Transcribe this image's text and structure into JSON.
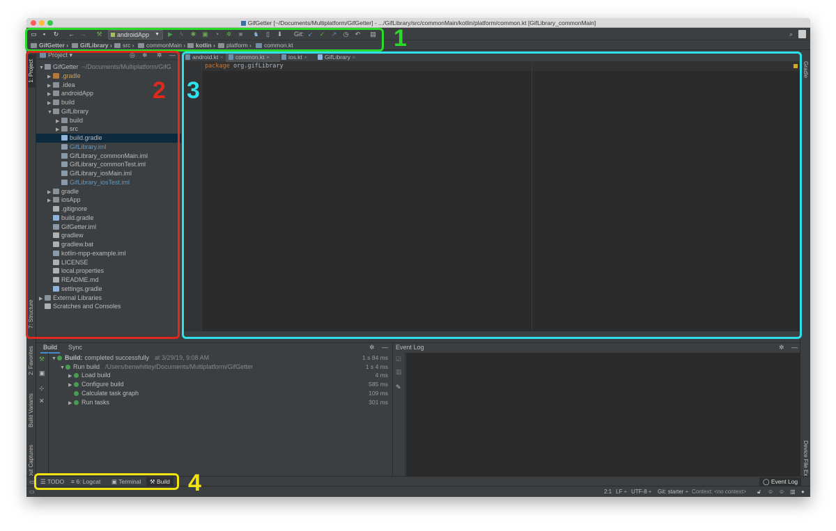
{
  "window": {
    "title": "GifGetter [~/Documents/Multiplatform/GifGetter] - .../GifLibrary/src/commonMain/kotlin/platform/common.kt [GifLibrary_commonMain]"
  },
  "toolbar": {
    "run_config": "androidApp",
    "git_label": "Git:"
  },
  "navbar": {
    "crumbs": [
      "GifGetter",
      "GifLibrary",
      "src",
      "commonMain",
      "kotlin",
      "platform",
      "common.kt"
    ]
  },
  "left_stripe": {
    "project_tab": "1: Project",
    "structure_tab": "7: Structure",
    "favorites_tab": "2: Favorites",
    "build_variants_tab": "Build Variants",
    "layout_captures_tab": "Layout Captures"
  },
  "project_panel": {
    "view_selector": "Project",
    "tree": [
      {
        "label": "GifGetter",
        "path": "~/Documents/Multiplatform/GifG",
        "depth": 0,
        "arrow": "▼"
      },
      {
        "label": ".gradle",
        "depth": 1,
        "arrow": "▶"
      },
      {
        "label": ".idea",
        "depth": 1,
        "arrow": "▶"
      },
      {
        "label": "androidApp",
        "depth": 1,
        "arrow": "▶"
      },
      {
        "label": "build",
        "depth": 1,
        "arrow": "▶"
      },
      {
        "label": "GifLibrary",
        "depth": 1,
        "arrow": "▼"
      },
      {
        "label": "build",
        "depth": 2,
        "arrow": "▶"
      },
      {
        "label": "src",
        "depth": 2,
        "arrow": "▶"
      },
      {
        "label": "build.gradle",
        "depth": 2,
        "arrow": ""
      },
      {
        "label": "GifLibrary.iml",
        "depth": 2,
        "arrow": ""
      },
      {
        "label": "GifLibrary_commonMain.iml",
        "depth": 2,
        "arrow": ""
      },
      {
        "label": "GifLibrary_commonTest.iml",
        "depth": 2,
        "arrow": ""
      },
      {
        "label": "GifLibrary_iosMain.iml",
        "depth": 2,
        "arrow": ""
      },
      {
        "label": "GifLibrary_iosTest.iml",
        "depth": 2,
        "arrow": ""
      },
      {
        "label": "gradle",
        "depth": 1,
        "arrow": "▶"
      },
      {
        "label": "iosApp",
        "depth": 1,
        "arrow": "▶"
      },
      {
        "label": ".gitignore",
        "depth": 1,
        "arrow": ""
      },
      {
        "label": "build.gradle",
        "depth": 1,
        "arrow": ""
      },
      {
        "label": "GifGetter.iml",
        "depth": 1,
        "arrow": ""
      },
      {
        "label": "gradlew",
        "depth": 1,
        "arrow": ""
      },
      {
        "label": "gradlew.bat",
        "depth": 1,
        "arrow": ""
      },
      {
        "label": "kotlin-mpp-example.iml",
        "depth": 1,
        "arrow": ""
      },
      {
        "label": "LICENSE",
        "depth": 1,
        "arrow": ""
      },
      {
        "label": "local.properties",
        "depth": 1,
        "arrow": ""
      },
      {
        "label": "README.md",
        "depth": 1,
        "arrow": ""
      },
      {
        "label": "settings.gradle",
        "depth": 1,
        "arrow": ""
      },
      {
        "label": "External Libraries",
        "depth": 0,
        "arrow": "▶"
      },
      {
        "label": "Scratches and Consoles",
        "depth": 0,
        "arrow": ""
      }
    ]
  },
  "editor": {
    "tabs": [
      {
        "label": "android.kt"
      },
      {
        "label": "common.kt"
      },
      {
        "label": "ios.kt"
      },
      {
        "label": "GifLibrary"
      }
    ],
    "code_keyword": "package",
    "code_package": "org.gifLibrary"
  },
  "right_stripe": {
    "gradle_tab": "Gradle",
    "device_explorer_tab": "Device File Explorer"
  },
  "build_panel": {
    "tabs": [
      "Build",
      "Sync"
    ],
    "rows": [
      {
        "label": "Build:",
        "detail": "completed successfully",
        "extra": "at 3/29/19, 9:08 AM",
        "time": "1 s 84 ms",
        "depth": 0,
        "arrow": "▼"
      },
      {
        "label": "Run build",
        "detail": "",
        "extra": "/Users/benwhitley/Documents/Multiplatform/GifGetter",
        "time": "1 s 4 ms",
        "depth": 1,
        "arrow": "▼"
      },
      {
        "label": "Load build",
        "detail": "",
        "extra": "",
        "time": "4 ms",
        "depth": 2,
        "arrow": "▶"
      },
      {
        "label": "Configure build",
        "detail": "",
        "extra": "",
        "time": "585 ms",
        "depth": 2,
        "arrow": "▶"
      },
      {
        "label": "Calculate task graph",
        "detail": "",
        "extra": "",
        "time": "109 ms",
        "depth": 2,
        "arrow": ""
      },
      {
        "label": "Run tasks",
        "detail": "",
        "extra": "",
        "time": "301 ms",
        "depth": 2,
        "arrow": "▶"
      }
    ]
  },
  "event_log": {
    "title": "Event Log"
  },
  "bottom_tools": {
    "todo": "TODO",
    "logcat": "6: Logcat",
    "terminal": "Terminal",
    "build": "Build",
    "event_log": "Event Log"
  },
  "status_bar": {
    "position": "2:1",
    "line_sep": "LF ÷",
    "encoding": "UTF-8 ÷",
    "git": "Git: starter ÷",
    "context": "Context: <no context>"
  },
  "annotations": {
    "colors": {
      "toolbar": "#2bd92b",
      "project": "#e0291d",
      "editor": "#2ee0ea",
      "tools": "#f2e20d"
    },
    "labels": [
      "1",
      "2",
      "3",
      "4"
    ]
  }
}
